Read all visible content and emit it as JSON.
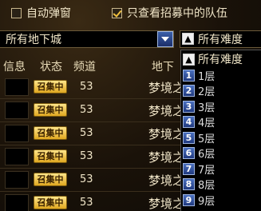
{
  "filters": {
    "auto_popup_label": "自动弹窗",
    "auto_popup_checked": false,
    "recruiting_only_label": "只查看招募中的队伍",
    "recruiting_only_checked": true
  },
  "dungeon_select": {
    "value": "所有地下城"
  },
  "difficulty_select": {
    "value": "所有难度"
  },
  "table": {
    "headers": {
      "info": "信息",
      "status": "状态",
      "channel": "频道",
      "dungeon": "地下"
    },
    "rows": [
      {
        "status": "召集中",
        "channel": "53",
        "dungeon": "梦境之"
      },
      {
        "status": "召集中",
        "channel": "53",
        "dungeon": "梦境之"
      },
      {
        "status": "召集中",
        "channel": "53",
        "dungeon": "梦境之"
      },
      {
        "status": "召集中",
        "channel": "53",
        "dungeon": "梦境之"
      },
      {
        "status": "召集中",
        "channel": "53",
        "dungeon": "梦境之"
      },
      {
        "status": "召集中",
        "channel": "53",
        "dungeon": "梦境之"
      }
    ]
  },
  "difficulty_list": {
    "items": [
      {
        "icon": "▲",
        "label": "所有难度"
      },
      {
        "icon": "1",
        "label": "1层"
      },
      {
        "icon": "2",
        "label": "2层"
      },
      {
        "icon": "3",
        "label": "3层"
      },
      {
        "icon": "4",
        "label": "4层"
      },
      {
        "icon": "5",
        "label": "5层"
      },
      {
        "icon": "6",
        "label": "6层"
      },
      {
        "icon": "7",
        "label": "7层"
      },
      {
        "icon": "8",
        "label": "8层"
      },
      {
        "icon": "9",
        "label": "9层"
      }
    ]
  }
}
